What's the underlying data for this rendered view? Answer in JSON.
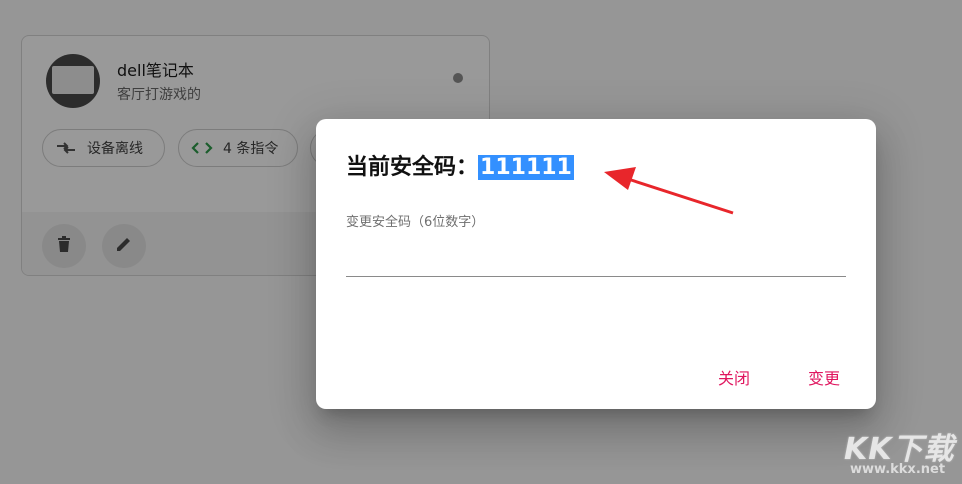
{
  "device_card": {
    "title": "dell笔记本",
    "subtitle": "客厅打游戏的",
    "chips": {
      "offline_label": "设备离线",
      "commands_label": "4 条指令"
    },
    "icons": {
      "offline": "swap-arrows-icon",
      "commands": "code-brackets-icon",
      "delete": "trash-icon",
      "edit": "pencil-icon"
    }
  },
  "dialog": {
    "title_prefix": "当前安全码：",
    "code": "111111",
    "field_label": "变更安全码（6位数字）",
    "field_value": "",
    "close_label": "关闭",
    "change_label": "变更"
  },
  "watermark": {
    "main": "KK下载",
    "url": "www.kkx.net"
  },
  "colors": {
    "accent": "#e0165f",
    "selection": "#3390ff",
    "annotation_arrow": "#e8262b",
    "command_icon": "#2e9b4a"
  }
}
